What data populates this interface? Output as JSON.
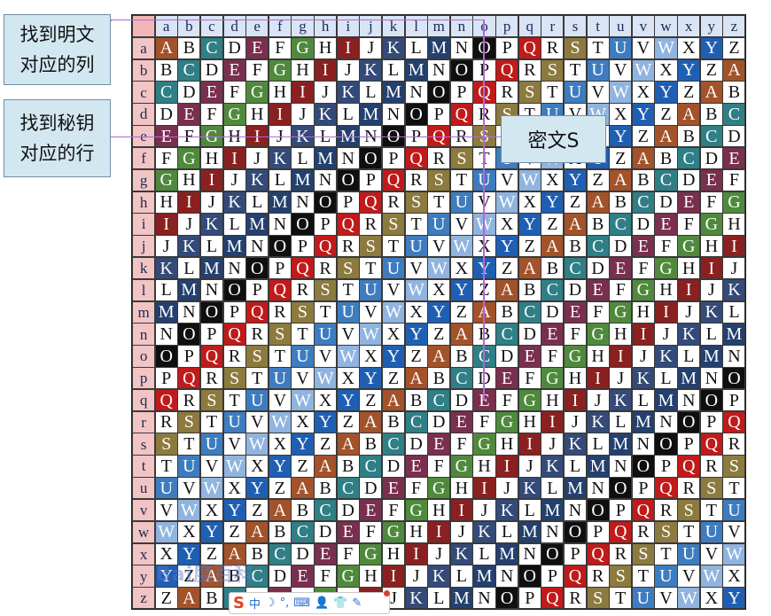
{
  "table": {
    "letters": [
      "a",
      "b",
      "c",
      "d",
      "e",
      "f",
      "g",
      "h",
      "i",
      "j",
      "k",
      "l",
      "m",
      "n",
      "o",
      "p",
      "q",
      "r",
      "s",
      "t",
      "u",
      "v",
      "w",
      "x",
      "y",
      "z"
    ],
    "palette": {
      "A": [
        "#a3522a",
        "#ffffff"
      ],
      "B": [
        "#ffffff",
        "#111111"
      ],
      "C": [
        "#2f7f86",
        "#ffffff"
      ],
      "D": [
        "#ffffff",
        "#111111"
      ],
      "E": [
        "#7a2f4e",
        "#ffffff"
      ],
      "F": [
        "#ffffff",
        "#111111"
      ],
      "G": [
        "#4f8a3c",
        "#ffffff"
      ],
      "H": [
        "#ffffff",
        "#111111"
      ],
      "I": [
        "#8a2020",
        "#ffffff"
      ],
      "J": [
        "#ffffff",
        "#111111"
      ],
      "K": [
        "#344a78",
        "#ffffff"
      ],
      "L": [
        "#ffffff",
        "#111111"
      ],
      "M": [
        "#23406e",
        "#ffffff"
      ],
      "N": [
        "#ffffff",
        "#111111"
      ],
      "O": [
        "#0f0f0f",
        "#ffffff"
      ],
      "P": [
        "#ffffff",
        "#111111"
      ],
      "Q": [
        "#c11a1a",
        "#ffffff"
      ],
      "R": [
        "#ffffff",
        "#111111"
      ],
      "S": [
        "#8c7a3e",
        "#ffffff"
      ],
      "T": [
        "#ffffff",
        "#111111"
      ],
      "U": [
        "#3e7cc0",
        "#ffffff"
      ],
      "V": [
        "#ffffff",
        "#111111"
      ],
      "W": [
        "#8fb4df",
        "#ffffff"
      ],
      "X": [
        "#ffffff",
        "#111111"
      ],
      "Y": [
        "#1f5fb3",
        "#ffffff"
      ],
      "Z": [
        "#ffffff",
        "#111111"
      ]
    }
  },
  "callouts": {
    "find_column": [
      "找到明文",
      "对应的列"
    ],
    "find_row": [
      "找到秘钥",
      "对应的行"
    ],
    "ciphertext": "密文S"
  },
  "watermark": "Bai度百科",
  "toolbar": {
    "logo": "S",
    "items": [
      "中",
      "☽",
      "°,",
      "⌨",
      "👤",
      "👕",
      "✎"
    ]
  }
}
